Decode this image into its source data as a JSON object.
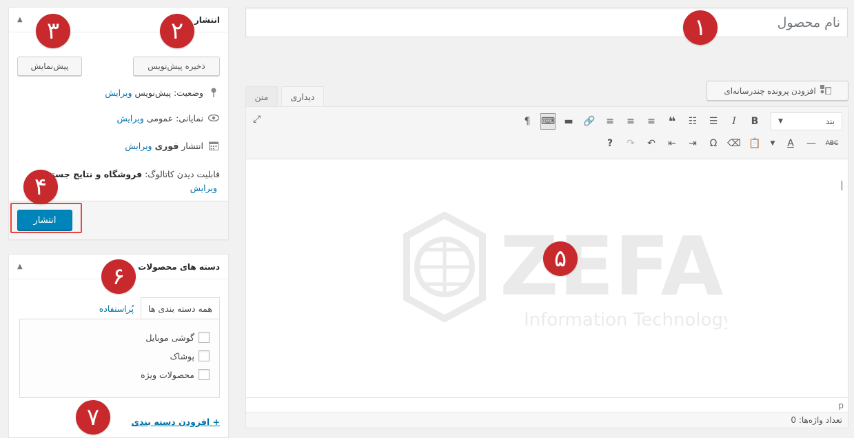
{
  "publish_box": {
    "title": "انتشار",
    "save_draft_label": "ذخیره پیش‌نویس",
    "preview_label": "پیش‌نمایش",
    "status_label": "وضعیت:",
    "status_value": "پیش‌نویس",
    "edit_label": "ویرایش",
    "visibility_label": "نمایانی:",
    "visibility_value": "عمومی",
    "publish_time_label": "انتشار",
    "publish_time_value": "فوری",
    "catalog_label": "قابلیت دیدن کاتالوگ:",
    "catalog_value": "فروشگاه و نتایج جستجو",
    "publish_button_label": "انتشار"
  },
  "categories_box": {
    "title": "دسته های محصولات",
    "tab_all": "همه دسته بندی ها",
    "tab_popular": "پُراستفاده",
    "items": [
      "گوشی موبایل",
      "پوشاک",
      "محصولات ویژه"
    ],
    "add_new_label": "+ افزودن دسته بندی"
  },
  "editor": {
    "title_placeholder": "نام محصول",
    "add_media_label": "افزودن پرونده چندرسانه‌ای",
    "tab_visual": "دیداری",
    "tab_text": "متن",
    "format_select_value": "بند",
    "path_label": "p",
    "word_count_label": "تعداد واژه‌ها: 0"
  },
  "watermark": {
    "brand": "ZEFA",
    "tagline": "Information Technology"
  },
  "markers": [
    "۱",
    "۲",
    "۳",
    "۴",
    "۵",
    "۶",
    "۷"
  ],
  "colors": {
    "marker_red": "#c7292d",
    "primary_blue": "#0085ba",
    "link_blue": "#0073aa",
    "highlight_red": "#e8443a"
  }
}
